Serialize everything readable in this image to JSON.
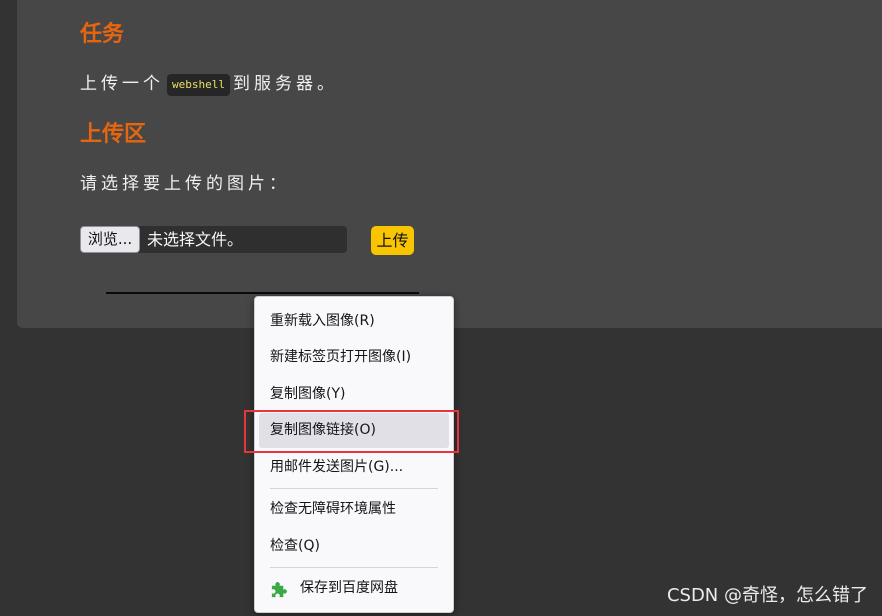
{
  "task": {
    "heading": "任务",
    "text_before": "上传一个",
    "code": "webshell",
    "text_after": "到服务器。"
  },
  "upload": {
    "heading": "上传区",
    "prompt": "请选择要上传的图片：",
    "browse_label": "浏览...",
    "no_file_text": "未选择文件。",
    "submit_label": "上传"
  },
  "context_menu": {
    "items": [
      "重新载入图像(R)",
      "新建标签页打开图像(I)",
      "复制图像(Y)",
      "复制图像链接(O)",
      "用邮件发送图片(G)...",
      "检查无障碍环境属性",
      "检查(Q)"
    ],
    "extension_item": "保存到百度网盘",
    "extension_icon": "puzzle-piece-icon",
    "highlighted_index": 3
  },
  "colors": {
    "heading": "#e8650f",
    "upload_button": "#f9c400",
    "highlight_box": "#e8353b",
    "extension_icon": "#3aa845"
  },
  "watermark": "CSDN @奇怪，怎么错了"
}
